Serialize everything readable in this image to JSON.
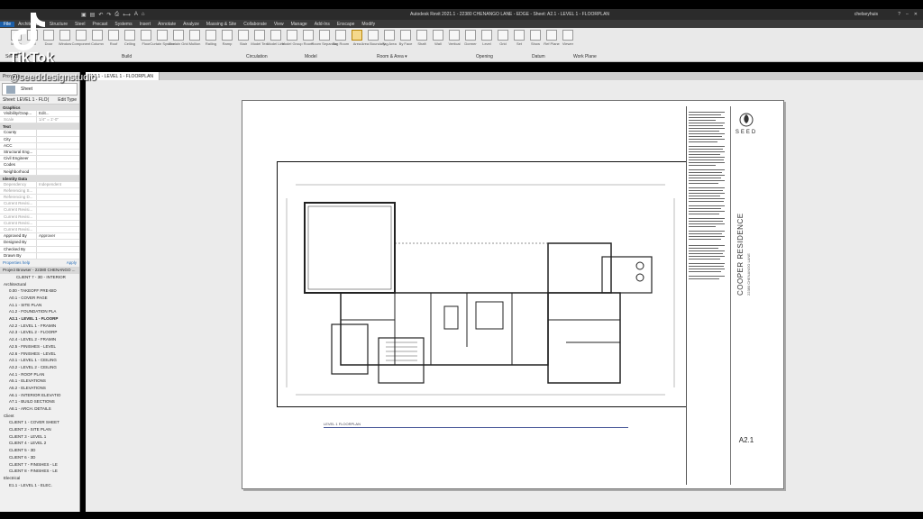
{
  "app": {
    "title": "Autodesk Revit 2021.1 - 22380 CHENANGO LANE - EDGE - Sheet: A2.1 - LEVEL 1 - FLOORPLAN",
    "user": "chelseyhuis",
    "help": "?"
  },
  "ribbon": {
    "tabs": [
      {
        "label": "File",
        "active": true
      },
      {
        "label": "Architecture",
        "active": false
      },
      {
        "label": "Structure",
        "active": false
      },
      {
        "label": "Steel",
        "active": false
      },
      {
        "label": "Precast",
        "active": false
      },
      {
        "label": "Systems",
        "active": false
      },
      {
        "label": "Insert",
        "active": false
      },
      {
        "label": "Annotate",
        "active": false
      },
      {
        "label": "Analyze",
        "active": false
      },
      {
        "label": "Massing & Site",
        "active": false
      },
      {
        "label": "Collaborate",
        "active": false
      },
      {
        "label": "View",
        "active": false
      },
      {
        "label": "Manage",
        "active": false
      },
      {
        "label": "Add-Ins",
        "active": false
      },
      {
        "label": "Enscape",
        "active": false
      },
      {
        "label": "Modify",
        "active": false
      }
    ],
    "tools": [
      "Modify",
      "Wall",
      "Door",
      "Window",
      "Component",
      "Column",
      "Roof",
      "Ceiling",
      "Floor",
      "Curtain System",
      "Curtain Grid",
      "Mullion",
      "Railing",
      "Ramp",
      "Stair",
      "Model Text",
      "Model Line",
      "Model Group",
      "Room",
      "Room Separator",
      "Tag Room",
      "Area",
      "Area Boundary",
      "Tag Area",
      "By Face",
      "Shaft",
      "Wall",
      "Vertical",
      "Dormer",
      "Level",
      "Grid",
      "Set",
      "Show",
      "Ref Plane",
      "Viewer"
    ],
    "groups": {
      "select": "Select",
      "build": "Build",
      "circulation": "Circulation",
      "model": "Model",
      "room_area": "Room & Area ▾",
      "opening": "Opening",
      "datum": "Datum",
      "work_plane": "Work Plane"
    }
  },
  "view_tabs": [
    "A2.1 - LEVEL 1 - FLOORPLAN"
  ],
  "properties": {
    "header": "Properties",
    "type": "Sheet",
    "instance_label": "Sheet: LEVEL 1 - FLO(",
    "edit_type": "Edit Type",
    "sections": [
      {
        "name": "Graphics",
        "rows": [
          {
            "k": "Visibility/Grap...",
            "v": "Edit...",
            "dim": false
          },
          {
            "k": "Scale",
            "v": "1/4\" = 1'-0\"",
            "dim": true
          }
        ]
      },
      {
        "name": "Text",
        "rows": [
          {
            "k": "County",
            "v": "",
            "dim": false
          },
          {
            "k": "City",
            "v": "",
            "dim": false
          },
          {
            "k": "ACC",
            "v": "",
            "dim": false
          },
          {
            "k": "Structural Eng...",
            "v": "",
            "dim": false
          },
          {
            "k": "Civil Engineer",
            "v": "",
            "dim": false
          },
          {
            "k": "Codes",
            "v": "",
            "dim": false
          },
          {
            "k": "Neighborhood",
            "v": "",
            "dim": false
          }
        ]
      },
      {
        "name": "Identity Data",
        "rows": [
          {
            "k": "Dependency",
            "v": "Independent",
            "dim": true
          },
          {
            "k": "Referencing S...",
            "v": "",
            "dim": true
          },
          {
            "k": "Referencing D...",
            "v": "",
            "dim": true
          },
          {
            "k": "Current Revisi...",
            "v": "",
            "dim": true
          },
          {
            "k": "Current Revisi...",
            "v": "",
            "dim": true
          },
          {
            "k": "Current Revisi...",
            "v": "",
            "dim": true
          },
          {
            "k": "Current Revisi...",
            "v": "",
            "dim": true
          },
          {
            "k": "Current Revisi...",
            "v": "",
            "dim": true
          },
          {
            "k": "Approved By",
            "v": "Approver",
            "dim": false
          },
          {
            "k": "Designed By",
            "v": "",
            "dim": false
          },
          {
            "k": "Checked By",
            "v": "",
            "dim": false
          },
          {
            "k": "Drawn By",
            "v": "",
            "dim": false
          }
        ]
      }
    ],
    "help_link": "Properties help",
    "apply": "Apply"
  },
  "project_browser": {
    "header": "Project Browser - 22380 CHENANGO ...",
    "items": [
      {
        "label": "CLIENT 7 - 3D - INTERIOR",
        "level": 2,
        "bold": false
      },
      {
        "label": "Architectural",
        "level": 0,
        "bold": false
      },
      {
        "label": "0.00 - TAKEOFF PRE-BID",
        "level": 1,
        "bold": false
      },
      {
        "label": "A0.1 - COVER PAGE",
        "level": 1,
        "bold": false
      },
      {
        "label": "A1.1 - SITE PLAN",
        "level": 1,
        "bold": false
      },
      {
        "label": "A1.2 - FOUNDATION PLA",
        "level": 1,
        "bold": false
      },
      {
        "label": "A2.1 - LEVEL 1 - FLOORP",
        "level": 1,
        "bold": true
      },
      {
        "label": "A2.2 - LEVEL 1 - FRAMIN",
        "level": 1,
        "bold": false
      },
      {
        "label": "A2.3 - LEVEL 2 - FLOORP",
        "level": 1,
        "bold": false
      },
      {
        "label": "A2.4 - LEVEL 2 - FRAMIN",
        "level": 1,
        "bold": false
      },
      {
        "label": "A2.5 - FINISHES - LEVEL",
        "level": 1,
        "bold": false
      },
      {
        "label": "A2.6 - FINISHES - LEVEL",
        "level": 1,
        "bold": false
      },
      {
        "label": "A3.1 - LEVEL 1 - CEILING",
        "level": 1,
        "bold": false
      },
      {
        "label": "A3.2 - LEVEL 2 - CEILING",
        "level": 1,
        "bold": false
      },
      {
        "label": "A4.1 - ROOF PLAN",
        "level": 1,
        "bold": false
      },
      {
        "label": "A5.1 - ELEVATIONS",
        "level": 1,
        "bold": false
      },
      {
        "label": "A5.2 - ELEVATIONS",
        "level": 1,
        "bold": false
      },
      {
        "label": "A6.1 - INTERIOR ELEVATIO",
        "level": 1,
        "bold": false
      },
      {
        "label": "A7.1 - BUILD SECTIONS",
        "level": 1,
        "bold": false
      },
      {
        "label": "A8.1 - ARCH. DETAILS",
        "level": 1,
        "bold": false
      },
      {
        "label": "Client",
        "level": 0,
        "bold": false
      },
      {
        "label": "CLIENT 1 - COVER SHEET",
        "level": 1,
        "bold": false
      },
      {
        "label": "CLIENT 2 - SITE PLAN",
        "level": 1,
        "bold": false
      },
      {
        "label": "CLIENT 3 - LEVEL 1",
        "level": 1,
        "bold": false
      },
      {
        "label": "CLIENT 4 - LEVEL 2",
        "level": 1,
        "bold": false
      },
      {
        "label": "CLIENT 5 - 3D",
        "level": 1,
        "bold": false
      },
      {
        "label": "CLIENT 6 - 3D",
        "level": 1,
        "bold": false
      },
      {
        "label": "CLIENT 7 - FINISHES - LE",
        "level": 1,
        "bold": false
      },
      {
        "label": "CLIENT 8 - FINISHES - LE",
        "level": 1,
        "bold": false
      },
      {
        "label": "Electrical",
        "level": 0,
        "bold": false
      },
      {
        "label": "E1.1 - LEVEL 1 - ELEC.",
        "level": 1,
        "bold": false
      }
    ]
  },
  "sheet": {
    "brand": "SEED",
    "project_name": "COOPER RESIDENCE",
    "project_address": "22380 CHENANGO LANE",
    "sheet_number": "A2.1",
    "scale_label": "LEVEL 1 FLOORPLAN"
  },
  "overlay": {
    "platform": "TikTok",
    "handle": "@seeddesignstudio"
  },
  "colors": {
    "active_tab": "#1b5ea8",
    "canvas_bg": "#ebebeb",
    "ribbon_bg": "#e9e9e9"
  }
}
